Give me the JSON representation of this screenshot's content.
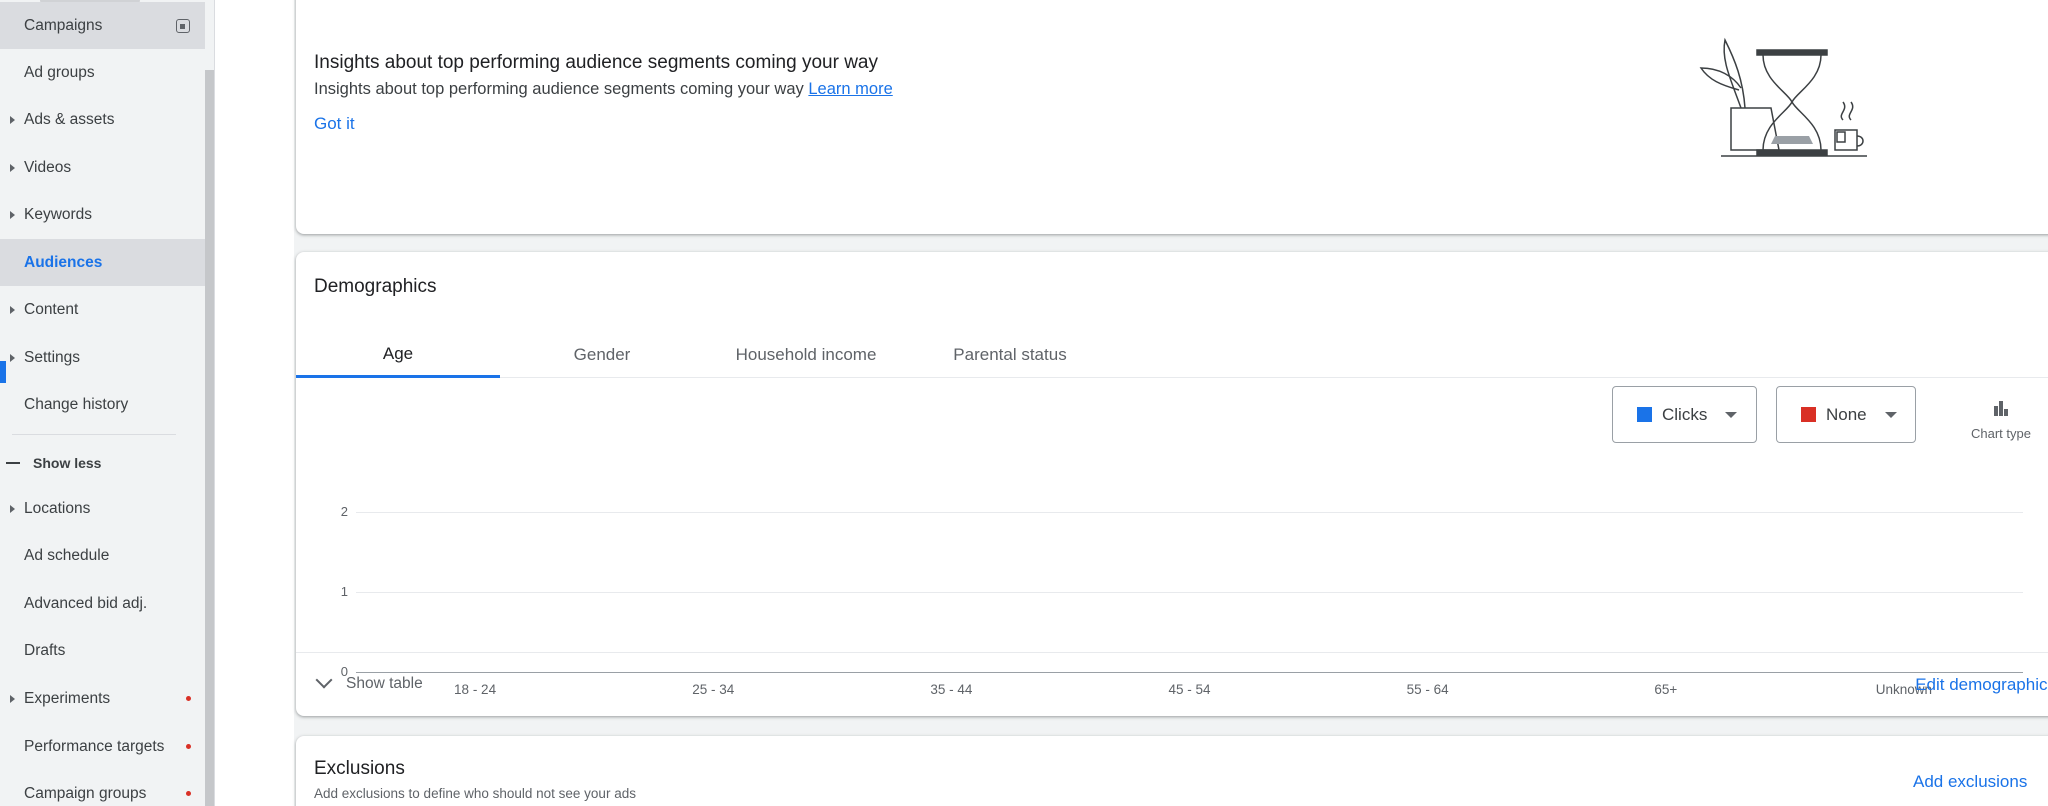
{
  "sidebar": {
    "items": [
      {
        "label": "Campaigns",
        "caret": false,
        "dot": false
      },
      {
        "label": "Ad groups",
        "caret": false,
        "dot": false
      },
      {
        "label": "Ads & assets",
        "caret": true,
        "dot": false
      },
      {
        "label": "Videos",
        "caret": true,
        "dot": false
      },
      {
        "label": "Keywords",
        "caret": true,
        "dot": false
      },
      {
        "label": "Audiences",
        "caret": false,
        "dot": false
      },
      {
        "label": "Content",
        "caret": true,
        "dot": false
      },
      {
        "label": "Settings",
        "caret": true,
        "dot": false
      },
      {
        "label": "Change history",
        "caret": false,
        "dot": false
      }
    ],
    "show_less": "Show less",
    "more_items": [
      {
        "label": "Locations"
      },
      {
        "label": "Ad schedule"
      },
      {
        "label": "Advanced bid adj."
      },
      {
        "label": "Drafts"
      },
      {
        "label": "Experiments"
      },
      {
        "label": "Performance targets"
      },
      {
        "label": "Campaign groups"
      }
    ]
  },
  "insights": {
    "title": "Insights about top performing audience segments coming your way",
    "description": "Insights about top performing audience segments coming your way",
    "learn_more": "Learn more",
    "got_it": "Got it"
  },
  "demographics": {
    "title": "Demographics",
    "tabs": [
      "Age",
      "Gender",
      "Household income",
      "Parental status"
    ],
    "metric1": {
      "label": "Clicks",
      "color": "#1a73e8"
    },
    "metric2": {
      "label": "None",
      "color": "#d93025"
    },
    "chart_type_label": "Chart type",
    "show_table": "Show table",
    "edit": "Edit demographics"
  },
  "chart_data": {
    "type": "bar",
    "categories": [
      "18 - 24",
      "25 - 34",
      "35 - 44",
      "45 - 54",
      "55 - 64",
      "65+",
      "Unknown"
    ],
    "series": [
      {
        "values": [
          0,
          0,
          0,
          0,
          0,
          0,
          0
        ]
      }
    ],
    "yticks": [
      "2",
      "1",
      "0"
    ],
    "ylim": [
      0,
      2
    ],
    "grid": true
  },
  "exclusions": {
    "title": "Exclusions",
    "description": "Add exclusions to define who should not see your ads",
    "add": "Add exclusions"
  }
}
